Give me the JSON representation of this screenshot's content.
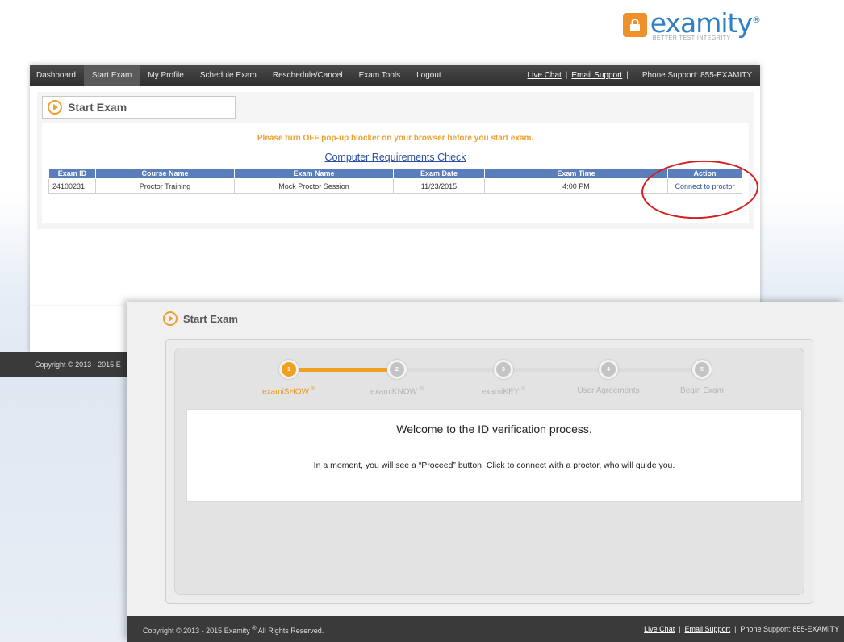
{
  "logo": {
    "word": "examity",
    "reg": "®",
    "tagline": "BETTER TEST INTEGRITY"
  },
  "nav": {
    "items": [
      "Dashboard",
      "Start Exam",
      "My Profile",
      "Schedule Exam",
      "Reschedule/Cancel",
      "Exam Tools",
      "Logout"
    ],
    "active": "Start Exam",
    "live_chat": "Live Chat",
    "email_support": "Email Support",
    "sep": "|",
    "phone": "Phone Support: 855-EXAMITY"
  },
  "start_exam": {
    "section_title": "Start Exam",
    "warning": "Please turn OFF pop-up blocker on your browser before you start exam.",
    "requirements_link": "Computer Requirements Check",
    "table": {
      "headers": [
        "Exam ID",
        "Course Name",
        "Exam Name",
        "Exam Date",
        "Exam Time",
        "Action"
      ],
      "rows": [
        {
          "exam_id": "24100231",
          "course_name": "Proctor Training",
          "exam_name": "Mock Proctor Session",
          "exam_date": "11/23/2015",
          "exam_time": "4:00 PM",
          "action": "Connect to proctor"
        }
      ]
    },
    "highlight_color": "#d42020"
  },
  "top_footer": {
    "copyright": "Copyright © 2013 - 2015 E"
  },
  "verification": {
    "section_title": "Start Exam",
    "steps": [
      {
        "number": "1",
        "label": "examiSHOW",
        "reg": "®",
        "active": true
      },
      {
        "number": "2",
        "label": "examiKNOW",
        "reg": "®",
        "active": false
      },
      {
        "number": "3",
        "label": "examiKEY",
        "reg": "®",
        "active": false
      },
      {
        "number": "4",
        "label": "User Agreements",
        "reg": "",
        "active": false
      },
      {
        "number": "5",
        "label": "Begin Exam",
        "reg": "",
        "active": false
      }
    ],
    "welcome_title": "Welcome to the ID verification process.",
    "welcome_text": "In a moment, you will see a “Proceed” button. Click to connect with a proctor, who will guide you."
  },
  "bottom_footer": {
    "copyright": "Copyright © 2013 - 2015 Examity",
    "reg": "®",
    "rights": "All Rights Reserved.",
    "live_chat": "Live Chat",
    "email_support": "Email Support",
    "sep": "|",
    "phone": "Phone Support: 855-EXAMITY"
  },
  "colors": {
    "accent_orange": "#f0a020",
    "brand_blue": "#2f7fc4",
    "table_header": "#5a7dbc",
    "nav_bg": "#3a3a3a"
  }
}
